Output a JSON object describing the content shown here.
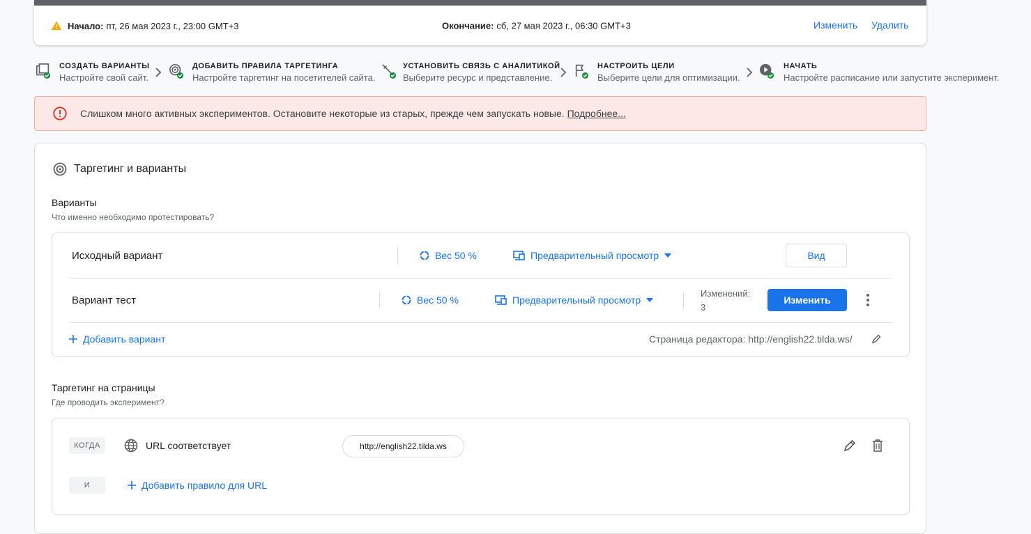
{
  "schedule": {
    "start_label": "Начало:",
    "start_value": "пт, 26 мая 2023 г., 23:00 GMT+3",
    "end_label": "Окончание:",
    "end_value": "сб, 27 мая 2023 г., 06:30 GMT+3",
    "edit_label": "Изменить",
    "delete_label": "Удалить"
  },
  "steps": [
    {
      "title": "СОЗДАТЬ ВАРИАНТЫ",
      "subtitle": "Настройте свой сайт.",
      "icon": "create-variants-icon"
    },
    {
      "title": "ДОБАВИТЬ ПРАВИЛА ТАРГЕТИНГА",
      "subtitle": "Настройте таргетинг на посетителей сайта.",
      "icon": "targeting-icon"
    },
    {
      "title": "УСТАНОВИТЬ СВЯЗЬ С АНАЛИТИКОЙ",
      "subtitle": "Выберите ресурс и представление.",
      "icon": "analytics-link-icon"
    },
    {
      "title": "НАСТРОИТЬ ЦЕЛИ",
      "subtitle": "Выберите цели для оптимизации.",
      "icon": "goals-flag-icon"
    },
    {
      "title": "НАЧАТЬ",
      "subtitle": "Настройте расписание или запустите эксперимент.",
      "icon": "start-play-icon"
    }
  ],
  "error_banner": {
    "message": "Слишком много активных экспериментов. Остановите некоторые из старых, прежде чем запускать новые.",
    "link": "Подробнее..."
  },
  "targeting_section": {
    "title": "Таргетинг и варианты",
    "variants_title": "Варианты",
    "variants_subtitle": "Что именно необходимо протестировать?",
    "variants": [
      {
        "name": "Исходный вариант",
        "weight": "Вес 50 %",
        "preview": "Предварительный просмотр",
        "button": "Вид"
      },
      {
        "name": "Вариант тест",
        "weight": "Вес 50 %",
        "preview": "Предварительный просмотр",
        "changes_label": "Изменений:",
        "changes_count": "3",
        "button": "Изменить"
      }
    ],
    "add_variant": "Добавить вариант",
    "editor_page": "Страница редактора: http://english22.tilda.ws/",
    "pages_title": "Таргетинг на страницы",
    "pages_subtitle": "Где проводить эксперимент?",
    "rule": {
      "when_chip": "КОГДА",
      "condition": "URL соответствует",
      "value": "http://english22.tilda.ws",
      "and_chip": "И",
      "add_rule": "Добавить правило для URL"
    }
  },
  "colors": {
    "accent": "#1a73e8",
    "success": "#1e8e3e",
    "warning": "#f9ab00",
    "error": "#d93025",
    "error_bg": "#fce8e6"
  }
}
